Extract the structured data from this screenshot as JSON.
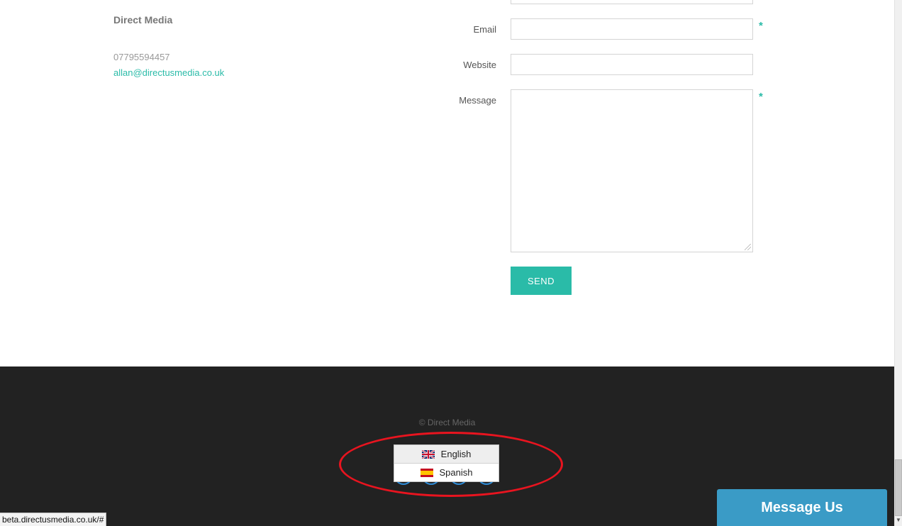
{
  "contact": {
    "company_name": "Direct Media",
    "phone": "07795594457",
    "email": "allan@directusmedia.co.uk"
  },
  "form": {
    "email_label": "Email",
    "email_value": "",
    "website_label": "Website",
    "website_value": "",
    "message_label": "Message",
    "message_value": "",
    "required_marker": "*",
    "send_label": "SEND"
  },
  "footer": {
    "copyright": "© Direct Media",
    "background_color": "#222222",
    "social_icons": [
      "social-icon-1",
      "social-icon-2",
      "social-icon-3",
      "social-icon-4"
    ]
  },
  "language_menu": {
    "items": [
      {
        "label": "English",
        "flag": "uk-flag-icon"
      },
      {
        "label": "Spanish",
        "flag": "spain-flag-icon"
      }
    ]
  },
  "chat_widget": {
    "label": "Message Us",
    "color": "#3a9bc6"
  },
  "status_bar": {
    "url": "beta.directusmedia.co.uk/#"
  },
  "accent_color": "#2abba8",
  "annotation_color": "#e8141f"
}
